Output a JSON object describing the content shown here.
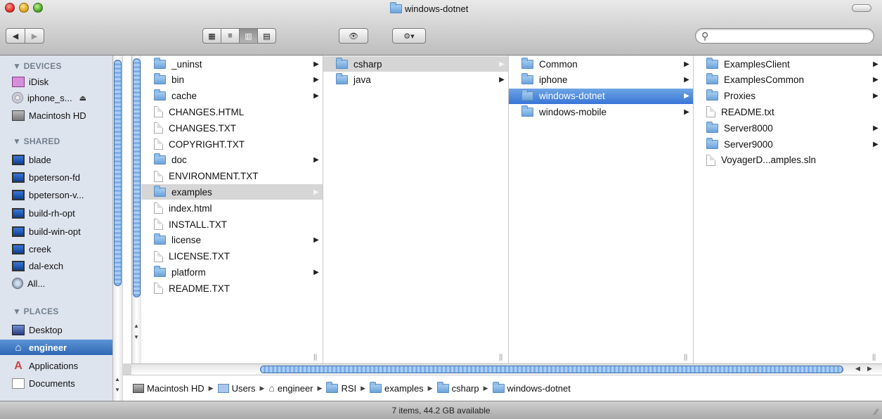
{
  "window": {
    "title": "windows-dotnet"
  },
  "toolbar": {
    "back": "◀",
    "forward": "▶",
    "views": [
      "▦",
      "≡",
      "▥",
      "▤"
    ],
    "eye": "👁",
    "action": "⚙▾",
    "search_placeholder": ""
  },
  "sidebar": {
    "devices_header": "▼ DEVICES",
    "devices": [
      "iDisk",
      "iphone_s...",
      "Macintosh HD"
    ],
    "shared_header": "▼ SHARED",
    "shared": [
      "blade",
      "bpeterson-fd",
      "bpeterson-v...",
      "build-rh-opt",
      "build-win-opt",
      "creek",
      "dal-exch",
      "All..."
    ],
    "places_header": "▼ PLACES",
    "places": [
      "Desktop",
      "engineer",
      "Applications",
      "Documents"
    ]
  },
  "columns": {
    "col1": [
      {
        "name": "_uninst",
        "kind": "folder",
        "arrow": true
      },
      {
        "name": "bin",
        "kind": "folder",
        "arrow": true
      },
      {
        "name": "cache",
        "kind": "folder",
        "arrow": true
      },
      {
        "name": "CHANGES.HTML",
        "kind": "file",
        "arrow": false
      },
      {
        "name": "CHANGES.TXT",
        "kind": "file",
        "arrow": false
      },
      {
        "name": "COPYRIGHT.TXT",
        "kind": "file",
        "arrow": false
      },
      {
        "name": "doc",
        "kind": "folder",
        "arrow": true
      },
      {
        "name": "ENVIRONMENT.TXT",
        "kind": "file",
        "arrow": false
      },
      {
        "name": "examples",
        "kind": "folder",
        "arrow": true,
        "selected": "gray"
      },
      {
        "name": "index.html",
        "kind": "file",
        "arrow": false
      },
      {
        "name": "INSTALL.TXT",
        "kind": "file",
        "arrow": false
      },
      {
        "name": "license",
        "kind": "folder",
        "arrow": true
      },
      {
        "name": "LICENSE.TXT",
        "kind": "file",
        "arrow": false
      },
      {
        "name": "platform",
        "kind": "folder",
        "arrow": true
      },
      {
        "name": "README.TXT",
        "kind": "file",
        "arrow": false
      }
    ],
    "col2": [
      {
        "name": "csharp",
        "kind": "folder",
        "arrow": true,
        "selected": "gray"
      },
      {
        "name": "java",
        "kind": "folder",
        "arrow": true
      }
    ],
    "col3": [
      {
        "name": "Common",
        "kind": "folder",
        "arrow": true
      },
      {
        "name": "iphone",
        "kind": "folder",
        "arrow": true
      },
      {
        "name": "windows-dotnet",
        "kind": "folder",
        "arrow": true,
        "selected": "blue"
      },
      {
        "name": "windows-mobile",
        "kind": "folder",
        "arrow": true
      }
    ],
    "col4": [
      {
        "name": "ExamplesClient",
        "kind": "folder",
        "arrow": true
      },
      {
        "name": "ExamplesCommon",
        "kind": "folder",
        "arrow": true
      },
      {
        "name": "Proxies",
        "kind": "folder",
        "arrow": true
      },
      {
        "name": "README.txt",
        "kind": "file",
        "arrow": false
      },
      {
        "name": "Server8000",
        "kind": "folder",
        "arrow": true
      },
      {
        "name": "Server9000",
        "kind": "folder",
        "arrow": true
      },
      {
        "name": "VoyagerD...amples.sln",
        "kind": "file",
        "arrow": false
      }
    ]
  },
  "pathbar": [
    "Macintosh HD",
    "Users",
    "engineer",
    "RSI",
    "examples",
    "csharp",
    "windows-dotnet"
  ],
  "status": {
    "text": "7 items, 44.2 GB available"
  },
  "colors": {
    "selection_blue": "#3875d7",
    "sidebar_bg": "#dde4ee",
    "selected_gray": "#d6d6d6"
  }
}
